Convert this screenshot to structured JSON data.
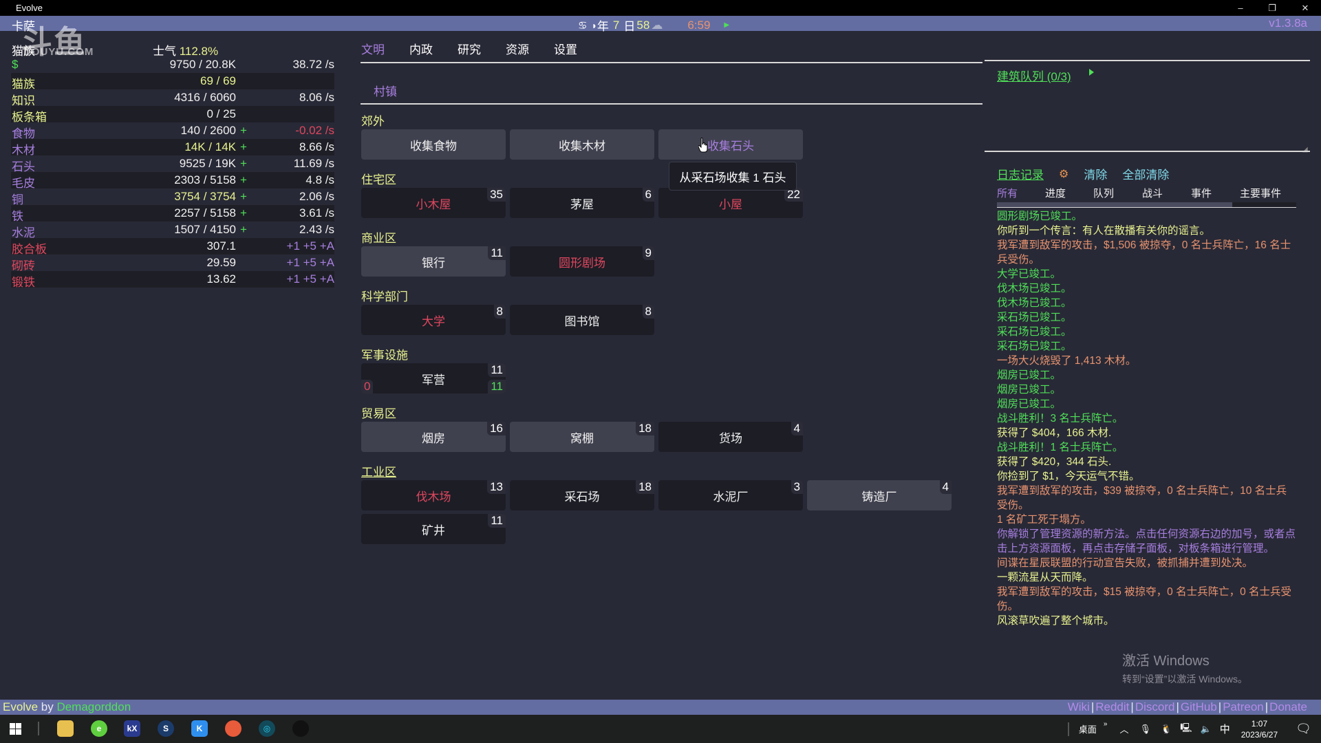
{
  "window": {
    "title": "Evolve",
    "controls": {
      "minimize": "–",
      "restore": "❐",
      "close": "✕"
    }
  },
  "topbar": {
    "city": "卡萨",
    "zodiac_icon": "♋",
    "moon_icon": "◗",
    "year_label": "年",
    "year": "7",
    "day_label": "日",
    "day": "58",
    "weather_icon": "☁",
    "time": "6:59",
    "play_icon": "▶",
    "version": "v1.3.8a"
  },
  "watermark": {
    "logo": "斗鱼",
    "site": "DOUYU.COM"
  },
  "resources": {
    "race": "猫族",
    "morale_label": "士气",
    "morale_value": "112.8%",
    "rows": [
      {
        "name": "$",
        "amount": "9750 / 20.8K",
        "plus": "",
        "rate": "38.72 /s",
        "name_color": "green"
      },
      {
        "name": "猫族",
        "amount": "69 / 69",
        "plus": "",
        "rate": "",
        "name_color": "yellow"
      },
      {
        "name": "知识",
        "amount": "4316 / 6060",
        "plus": "",
        "rate": "8.06 /s",
        "name_color": "yellow"
      },
      {
        "name": "板条箱",
        "amount": "0 / 25",
        "plus": "",
        "rate": "",
        "name_color": "yellow"
      },
      {
        "name": "食物",
        "amount": "140 / 2600",
        "plus": "+",
        "rate": "-0.02 /s",
        "name_color": "purple"
      },
      {
        "name": "木材",
        "amount": "14K / 14K",
        "plus": "+",
        "rate": "8.66 /s",
        "name_color": "purple"
      },
      {
        "name": "石头",
        "amount": "9525 / 19K",
        "plus": "+",
        "rate": "11.69 /s",
        "name_color": "purple"
      },
      {
        "name": "毛皮",
        "amount": "2303 / 5158",
        "plus": "+",
        "rate": "4.8 /s",
        "name_color": "purple"
      },
      {
        "name": "铜",
        "amount": "3754 / 3754",
        "plus": "+",
        "rate": "2.06 /s",
        "name_color": "purple"
      },
      {
        "name": "铁",
        "amount": "2257 / 5158",
        "plus": "+",
        "rate": "3.61 /s",
        "name_color": "purple"
      },
      {
        "name": "水泥",
        "amount": "1507 / 4150",
        "plus": "+",
        "rate": "2.43 /s",
        "name_color": "purple"
      },
      {
        "name": "胶合板",
        "amount": "307.1",
        "plus": "",
        "rate": "+1 +5 +A",
        "name_color": "red"
      },
      {
        "name": "砌砖",
        "amount": "29.59",
        "plus": "",
        "rate": "+1 +5 +A",
        "name_color": "red"
      },
      {
        "name": "锻铁",
        "amount": "13.62",
        "plus": "",
        "rate": "+1 +5 +A",
        "name_color": "red"
      }
    ]
  },
  "main": {
    "tabs": [
      "文明",
      "内政",
      "研究",
      "资源",
      "设置"
    ],
    "active_tab": "文明",
    "subtab": "村镇",
    "sections": {
      "outskirts": "郊外",
      "residential": "住宅区",
      "commercial": "商业区",
      "science": "科学部门",
      "military": "军事设施",
      "trade": "贸易区",
      "industrial": "工业区"
    },
    "buildings": {
      "gather_food": {
        "label": "收集食物"
      },
      "gather_wood": {
        "label": "收集木材"
      },
      "gather_stone": {
        "label": "收集石头"
      },
      "cabin": {
        "label": "小木屋",
        "count": "35"
      },
      "hut": {
        "label": "茅屋",
        "count": "6"
      },
      "cottage": {
        "label": "小屋",
        "count": "22"
      },
      "bank": {
        "label": "银行",
        "count": "11"
      },
      "amphitheatre": {
        "label": "圆形剧场",
        "count": "9"
      },
      "university": {
        "label": "大学",
        "count": "8"
      },
      "library": {
        "label": "图书馆",
        "count": "8"
      },
      "barracks": {
        "label": "军营",
        "count": "11",
        "off": "0",
        "on": "11"
      },
      "smokehouse": {
        "label": "烟房",
        "count": "16"
      },
      "shed": {
        "label": "窝棚",
        "count": "18"
      },
      "warehouse": {
        "label": "货场",
        "count": "4"
      },
      "lumber_yard": {
        "label": "伐木场",
        "count": "13"
      },
      "quarry": {
        "label": "采石场",
        "count": "18"
      },
      "cement_plant": {
        "label": "水泥厂",
        "count": "3"
      },
      "foundry": {
        "label": "铸造厂",
        "count": "4"
      },
      "mine": {
        "label": "矿井",
        "count": "11"
      }
    },
    "tooltip": "从采石场收集 1 石头"
  },
  "sidebar": {
    "queue_title": "建筑队列 (0/3)",
    "queue_play_icon": "▶",
    "log_title": "日志记录",
    "gear_icon": "⚙",
    "clear_label": "清除",
    "clear_all_label": "全部清除",
    "log_tabs": [
      "所有",
      "进度",
      "队列",
      "战斗",
      "事件",
      "主要事件"
    ],
    "active_log_tab": "所有",
    "messages": [
      {
        "text": "圆形剧场已竣工。",
        "color": "#4fe058"
      },
      {
        "text": "你听到一个传言：有人在散播有关你的谣言。",
        "color": "#e8f28f"
      },
      {
        "text": "我军遭到敌军的攻击，$1,506 被掠夺，0 名士兵阵亡，16 名士兵受伤。",
        "color": "#e8936f"
      },
      {
        "text": "大学已竣工。",
        "color": "#4fe058"
      },
      {
        "text": "伐木场已竣工。",
        "color": "#4fe058"
      },
      {
        "text": "伐木场已竣工。",
        "color": "#4fe058"
      },
      {
        "text": "采石场已竣工。",
        "color": "#4fe058"
      },
      {
        "text": "采石场已竣工。",
        "color": "#4fe058"
      },
      {
        "text": "采石场已竣工。",
        "color": "#4fe058"
      },
      {
        "text": "一场大火烧毁了 1,413 木材。",
        "color": "#e8936f"
      },
      {
        "text": "烟房已竣工。",
        "color": "#4fe058"
      },
      {
        "text": "烟房已竣工。",
        "color": "#4fe058"
      },
      {
        "text": "烟房已竣工。",
        "color": "#4fe058"
      },
      {
        "text": "战斗胜利！3 名士兵阵亡。",
        "color": "#4fe058"
      },
      {
        "text": "获得了 $404，166 木材.",
        "color": "#e8f28f"
      },
      {
        "text": "战斗胜利！1 名士兵阵亡。",
        "color": "#4fe058"
      },
      {
        "text": "获得了 $420，344 石头.",
        "color": "#e8f28f"
      },
      {
        "text": "你捡到了 $1，今天运气不错。",
        "color": "#e8f28f"
      },
      {
        "text": "我军遭到敌军的攻击，$39 被掠夺，0 名士兵阵亡，10 名士兵受伤。",
        "color": "#e8936f"
      },
      {
        "text": "1 名矿工死于塌方。",
        "color": "#e8936f"
      },
      {
        "text": "你解锁了管理资源的新方法。点击任何资源右边的加号，或者点击上方资源面板，再点击存储子面板，对板条箱进行管理。",
        "color": "#a77fe0"
      },
      {
        "text": "间谍在星辰联盟的行动宣告失败，被抓捕并遭到处决。",
        "color": "#e8936f"
      },
      {
        "text": "一颗流星从天而降。",
        "color": "#e8f28f"
      },
      {
        "text": "我军遭到敌军的攻击，$15 被掠夺，0 名士兵阵亡，0 名士兵受伤。",
        "color": "#e8936f"
      },
      {
        "text": "风滚草吹遍了整个城市。",
        "color": "#e8f28f"
      }
    ]
  },
  "activation": {
    "title": "激活 Windows",
    "subtitle": "转到“设置”以激活 Windows。"
  },
  "footer": {
    "game": "Evolve",
    "by": " by ",
    "author": "Demagorddon",
    "links": [
      "Wiki",
      "Reddit",
      "Discord",
      "GitHub",
      "Patreon",
      "Donate"
    ]
  },
  "taskbar": {
    "desktop_label": "桌面",
    "ime": "中",
    "time": "1:07",
    "date": "2023/6/27"
  },
  "colors": {
    "bar": "#636da2",
    "background": "#282936",
    "accent_purple": "#a77fe0",
    "green": "#4fe058",
    "yellow": "#e8f28f",
    "red": "#e0475f",
    "salmon": "#e8936f"
  }
}
